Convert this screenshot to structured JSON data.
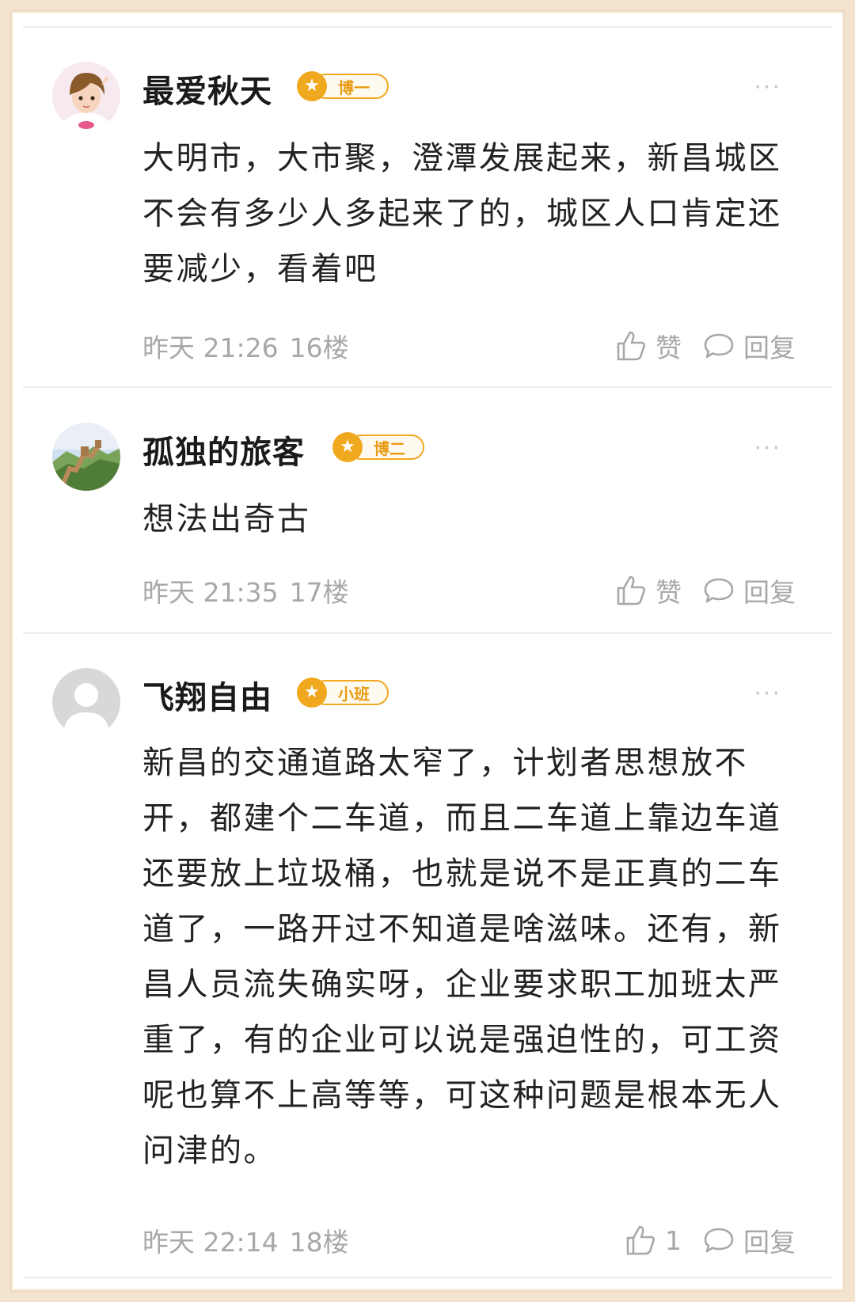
{
  "colors": {
    "badge": "#f0a81f",
    "meta": "#a8a8a8",
    "text": "#222222"
  },
  "more_label": "···",
  "comments": [
    {
      "username": "最爱秋天",
      "badge_level": "博一",
      "avatar": "anime-girl-avatar",
      "text": "大明市，大市聚，澄潭发展起来，新昌城区不会有多少人多起来了的，城区人口肯定还要减少，看着吧",
      "time": "昨天 21:26",
      "floor": "16楼",
      "like_label": "赞",
      "reply_label": "回复"
    },
    {
      "username": "孤独的旅客",
      "badge_level": "博二",
      "avatar": "great-wall-avatar",
      "text": "想法出奇古",
      "time": "昨天 21:35",
      "floor": "17楼",
      "like_label": "赞",
      "reply_label": "回复"
    },
    {
      "username": "飞翔自由",
      "badge_level": "小班",
      "avatar": "default-person-avatar",
      "text": "新昌的交通道路太窄了，计划者思想放不开，都建个二车道，而且二车道上靠边车道还要放上垃圾桶，也就是说不是正真的二车道了，一路开过不知道是啥滋味。还有，新昌人员流失确实呀，企业要求职工加班太严重了，有的企业可以说是强迫性的，可工资呢也算不上高等等，可这种问题是根本无人问津的。",
      "time": "昨天 22:14",
      "floor": "18楼",
      "like_label": "1",
      "reply_label": "回复"
    }
  ]
}
